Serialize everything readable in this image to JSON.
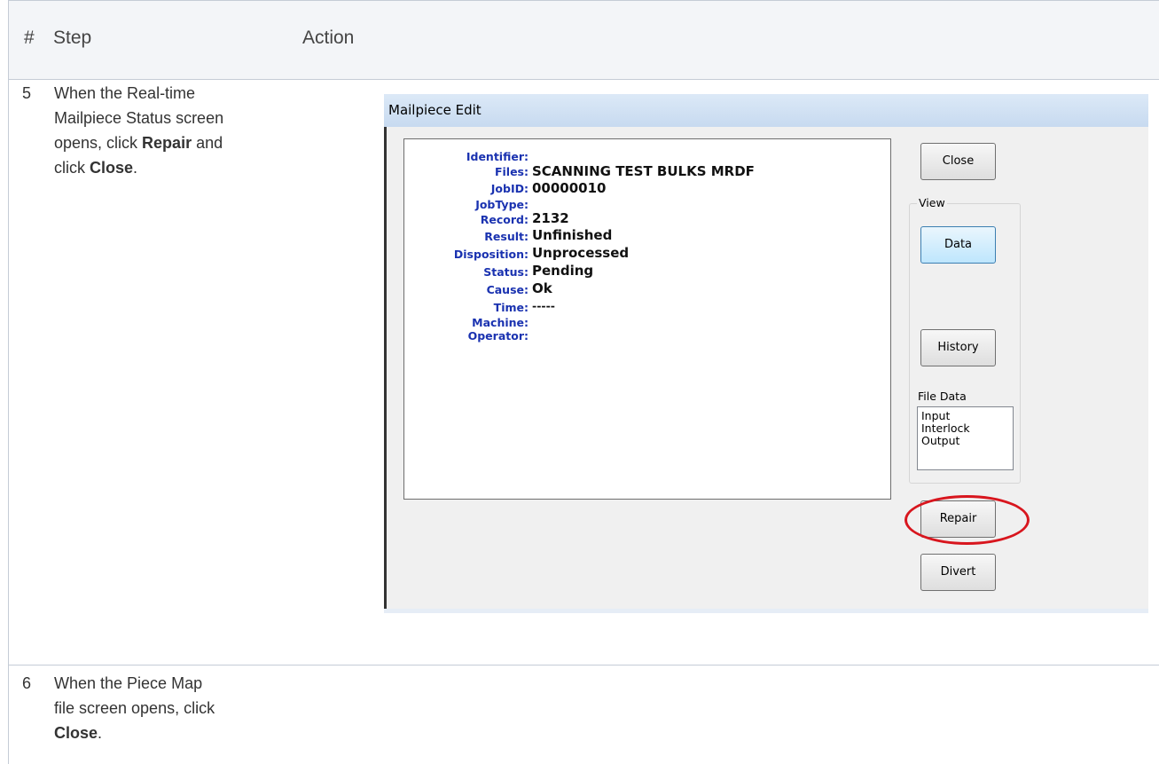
{
  "table": {
    "headers": {
      "num": "#",
      "step": "Step",
      "action": "Action"
    },
    "rows": [
      {
        "num": "5",
        "step_lines": [
          "When the Real-time",
          "Mailpiece Status screen",
          "opens, click ",
          "Repair",
          " and",
          "click ",
          "Close",
          "."
        ]
      },
      {
        "num": "6",
        "step_lines": [
          "When the Piece Map",
          "file screen opens, click",
          "Close",
          "."
        ]
      }
    ]
  },
  "dialog": {
    "title": "Mailpiece Edit",
    "fields": [
      {
        "label": "Identifier:",
        "value": ""
      },
      {
        "label": "Files:",
        "value": "SCANNING TEST BULKS MRDF"
      },
      {
        "label": "JobID:",
        "value": "00000010"
      },
      {
        "label": "JobType:",
        "value": ""
      },
      {
        "label": "Record:",
        "value": "2132"
      },
      {
        "label": "Result:",
        "value": "Unfinished"
      },
      {
        "label": "Disposition:",
        "value": "Unprocessed"
      },
      {
        "label": "Status:",
        "value": "Pending"
      },
      {
        "label": "Cause:",
        "value": "Ok"
      },
      {
        "label": "Time:",
        "value": "-----"
      },
      {
        "label": "Machine:",
        "value": ""
      },
      {
        "label": "Operator:",
        "value": ""
      }
    ],
    "buttons": {
      "close": "Close",
      "data": "Data",
      "history": "History",
      "repair": "Repair",
      "divert": "Divert"
    },
    "view_group_label": "View",
    "file_data_label": "File Data",
    "file_data_items": [
      "Input",
      "Interlock",
      "Output"
    ],
    "highlight_color": "#d8161e"
  }
}
